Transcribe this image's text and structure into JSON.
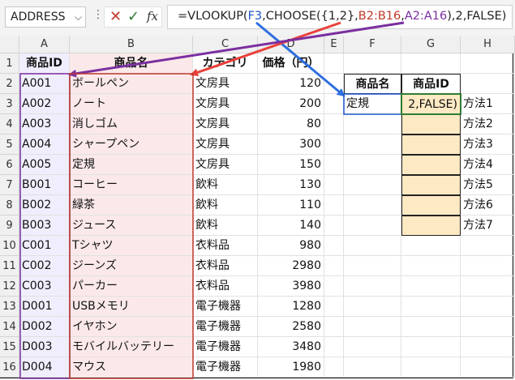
{
  "formula_bar": {
    "name_box": "ADDRESS",
    "name_dropdown_icon": "chevron-down-icon",
    "cancel_icon": "cancel-x-icon",
    "enter_icon": "check-icon",
    "fx_label": "fx",
    "formula_parts": [
      "=VLOOKUP(",
      "F3",
      ",CHOOSE({1,2},",
      "B2:B16",
      ",",
      "A2:A16",
      "),2,FALSE)"
    ]
  },
  "columns": [
    "A",
    "B",
    "C",
    "D",
    "E",
    "F",
    "G",
    "H"
  ],
  "rows": [
    "1",
    "2",
    "3",
    "4",
    "5",
    "6",
    "7",
    "8",
    "9",
    "10",
    "11",
    "12",
    "13",
    "14",
    "15",
    "16"
  ],
  "table": {
    "headers": [
      "商品ID",
      "商品名",
      "カテゴリ",
      "価格（円）"
    ],
    "data": [
      [
        "A001",
        "ボールペン",
        "文房具",
        "120"
      ],
      [
        "A002",
        "ノート",
        "文房具",
        "200"
      ],
      [
        "A003",
        "消しゴム",
        "文房具",
        "80"
      ],
      [
        "A004",
        "シャープペン",
        "文房具",
        "300"
      ],
      [
        "A005",
        "定規",
        "文房具",
        "150"
      ],
      [
        "B001",
        "コーヒー",
        "飲料",
        "130"
      ],
      [
        "B002",
        "緑茶",
        "飲料",
        "110"
      ],
      [
        "B003",
        "ジュース",
        "飲料",
        "140"
      ],
      [
        "C001",
        "Tシャツ",
        "衣料品",
        "980"
      ],
      [
        "C002",
        "ジーンズ",
        "衣料品",
        "2980"
      ],
      [
        "C003",
        "パーカー",
        "衣料品",
        "3980"
      ],
      [
        "D001",
        "USBメモリ",
        "電子機器",
        "1280"
      ],
      [
        "D002",
        "イヤホン",
        "電子機器",
        "2580"
      ],
      [
        "D003",
        "モバイルバッテリー",
        "電子機器",
        "3480"
      ],
      [
        "D004",
        "マウス",
        "電子機器",
        "1980"
      ]
    ]
  },
  "lookup": {
    "header_f": "商品名",
    "header_g": "商品ID",
    "input_f3": "定規",
    "editing_g3": "2,FALSE)",
    "methods": [
      "方法1",
      "方法2",
      "方法3",
      "方法4",
      "方法5",
      "方法6",
      "方法7"
    ]
  },
  "colors": {
    "range_b": "#c0392b",
    "range_a": "#7b2fa0",
    "ref_f3": "#1f55c9",
    "g_fill": "#fde9c3"
  }
}
